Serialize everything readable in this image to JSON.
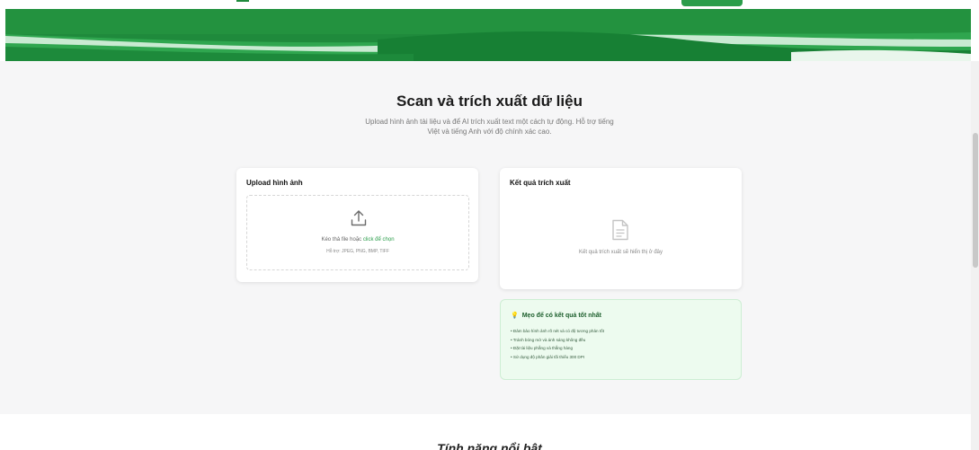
{
  "colors": {
    "brand_green": "#2a9d4a",
    "hero_dark": "#1a7f33",
    "tips_bg": "#edfbef"
  },
  "hero": {
    "top_nav_button_icon": "nav-pill"
  },
  "main": {
    "title": "Scan và trích xuất dữ liệu",
    "subtitle_line1": "Upload hình ảnh tài liệu và để AI trích xuất text một cách tự động. Hỗ trợ tiếng",
    "subtitle_line2": "Việt và tiếng Anh với độ chính xác cao."
  },
  "upload_card": {
    "heading": "Upload hình ảnh",
    "icon": "upload-icon",
    "drop_text": "Kéo thả file hoặc ",
    "drop_link": "click để chọn",
    "formats": "Hỗ trợ: JPEG, PNG, BMP, TIFF"
  },
  "result_card": {
    "heading": "Kết quả trích xuất",
    "icon": "document-icon",
    "placeholder": "Kết quả trích xuất sẽ hiển thị ở đây"
  },
  "tips": {
    "icon": "lightbulb-icon",
    "heading": "Mẹo để có kết quả tốt nhất",
    "items": [
      "• Đảm bảo hình ảnh rõ nét và có độ tương phản tốt",
      "• Tránh bóng mờ và ánh sáng không đều",
      "• Đặt tài liệu phẳng và thẳng hàng",
      "• Sử dụng độ phân giải tối thiểu 300 DPI"
    ]
  },
  "next_section": {
    "heading": "Tính năng nổi bật"
  }
}
